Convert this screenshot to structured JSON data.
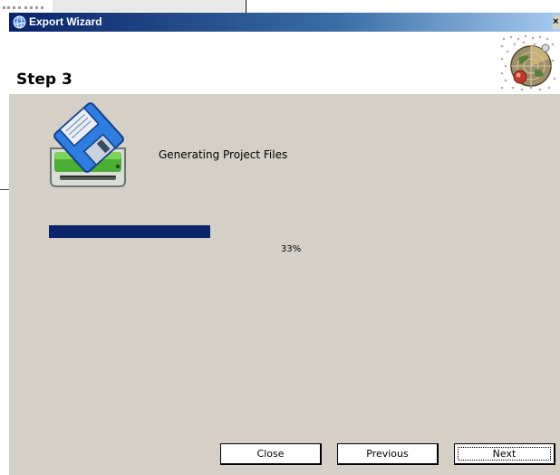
{
  "window": {
    "title": "Export Wizard",
    "close_glyph": "×",
    "icon": "globe-app-icon"
  },
  "header": {
    "step_title": "Step 3",
    "banner_icon": "globe-radar-icon"
  },
  "task": {
    "icon": "floppy-disk-drive-icon",
    "label": "Generating Project Files"
  },
  "progress": {
    "value_percent": 33,
    "label": "33%",
    "color": "#0a246a"
  },
  "buttons": {
    "close": "Close",
    "previous": "Previous",
    "next": "Next"
  },
  "colors": {
    "dialog_bg": "#d4d0c8",
    "titlebar_start": "#0a246a",
    "titlebar_end": "#a6caf0"
  }
}
